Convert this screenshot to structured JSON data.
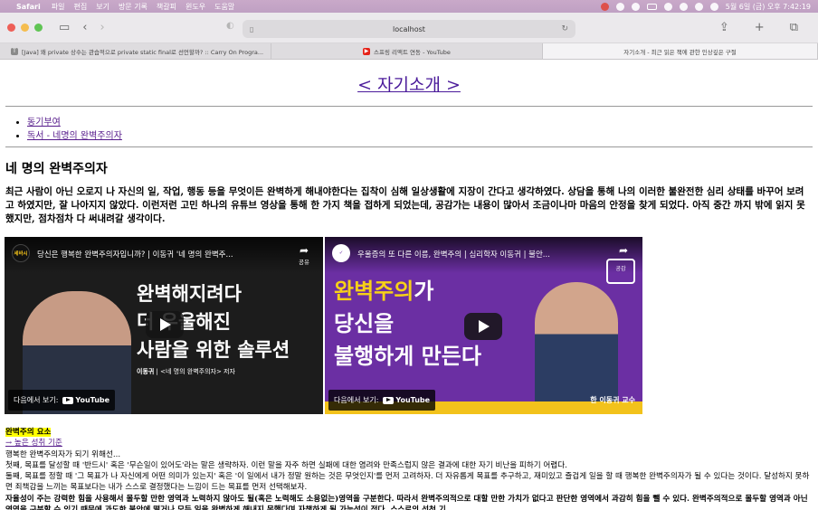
{
  "menubar": {
    "apple": "",
    "app": "Safari",
    "items": [
      "파일",
      "편집",
      "보기",
      "방문 기록",
      "책갈피",
      "윈도우",
      "도움말"
    ],
    "clock": "5월 6일 (금) 오후 7:42:19"
  },
  "toolbar": {
    "url": "localhost"
  },
  "tabs": [
    {
      "label": "[Java] 왜 private 상수는 관습적으로 private static final로 선언할까? :: Carry On Progra...",
      "favicon": "T"
    },
    {
      "label": "스프링 리액트 연동 - YouTube",
      "favicon": "▶"
    },
    {
      "label": "자기소개 - 최근 읽은 책에 관한 인상깊은 구절",
      "favicon": ""
    }
  ],
  "page": {
    "title": "< 자기소개 >",
    "nav": [
      "동기부여",
      "독서 - 네명의 완벽주의자"
    ],
    "heading": "네 명의 완벽주의자",
    "intro": "최근 사람이 아닌 오로지 나 자신의 일, 작업, 행동 등을 무엇이든 완벽하게 해내야한다는 집착이 심해 일상생활에 지장이 간다고 생각하였다. 상담을 통해 나의 이러한 불완전한 심리 상태를 바꾸어 보려고 하였지만, 잘 나아지지 않았다. 이런저런 고민 하나의 유튜브 영상을 통해 한 가지 책을 접하게 되었는데, 공감가는 내용이 많아서 조금이나마 마음의 안정을 찾게 되었다. 아직 중간 까지 밖에 읽지 못했지만, 점차점차 다 써내려갈 생각이다."
  },
  "videos": [
    {
      "channel": "세바시",
      "title": "당신은 행복한 완벽주의자입니까? | 이동귀 '네 명의 완벽주...",
      "share": "공유",
      "line1": "완벽해지려다",
      "line2": "더 우울해진",
      "line3": "사람을 위한 솔루션",
      "caption_name": "이동귀",
      "caption_rest": " | <네 명의 완벽주의자> 저자",
      "watch": "다음에서 보기:",
      "yt": "YouTube"
    },
    {
      "channel": "",
      "title": "우울증의 또 다른 이름, 완벽주의 | 심리학자 이동귀 | 불안...",
      "badge": "공감",
      "line1a": "완벽주의",
      "line1b": "가",
      "line2": "당신을",
      "line3": "불행하게 만든다",
      "caption": "한 이동귀 교수",
      "watch": "다음에서 보기:",
      "yt": "YouTube"
    }
  ],
  "content": {
    "section_title": "완벽주의 요소",
    "link": "→ 높은 성취 기준",
    "lines": [
      "행복한 완벽주의자가 되기 위해선...",
      "첫째, 목표를 달성할 때 '반드시' 혹은 '무슨일이 있어도'라는 말은 생략하자. 이런 말을 자주 하면 실패에 대한 염려와 만족스럽지 않은 결과에 대한 자기 비난을 피하기 어렵다.",
      "둘째, 목표를 정할 때 '그 목표가 나 자신에게 어떤 의미가 있는지' 혹은 '이 일에서 내가 정말 원하는 것은 무엇인지'를 먼저 고려하자. 더 자유롭게 목표를 추구하고, 재미있고 즐겁게 일을 할 때 행복한 완벽주의자가 될 수 있다는 것이다. 달성하지 못하면 죄책감을 느끼는 목표보다는 내가 스스로 결정했다는 느낌이 드는 목표를 먼저 선택해보자.",
      "자율성이 주는 강력한 힘을 사용해서 몰두할 만한 영역과 노력하지 않아도 될(혹은 노력해도 소용없는)영역을 구분한다. 따라서 완벽주의적으로 대할 만한 가치가 없다고 판단한 영역에서 과감히 힘을 뺄 수 있다. 완벽주의적으로 몰두할 영역과 아닌 영역을 구분할 수 있기 때문에 과도한 불안에 떨거나 모든 일을 완벽하게 해내지 못했다며 자책하게 될 가능성이 적다. 스스로의 선천 기"
    ]
  }
}
